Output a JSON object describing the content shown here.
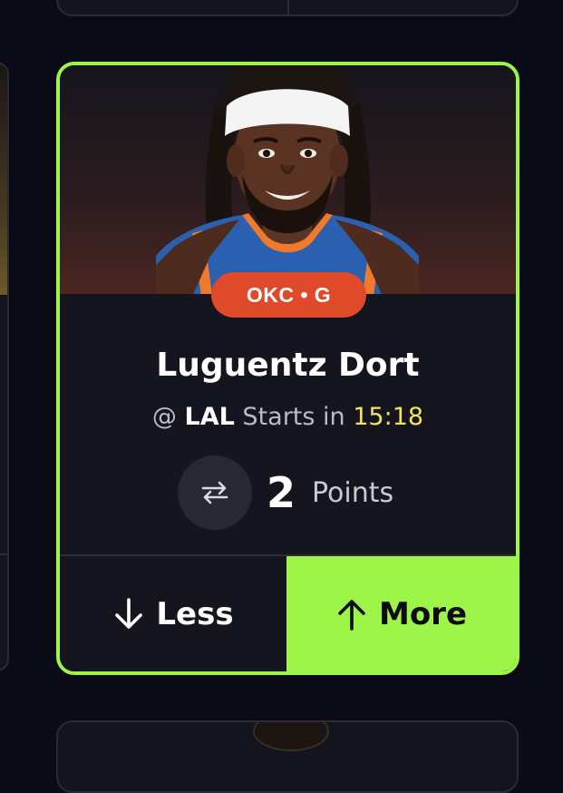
{
  "player": {
    "name": "Luguentz Dort",
    "team_badge": "OKC • G",
    "matchup_prefix": "@",
    "opponent": "LAL",
    "status_text": "Starts in",
    "countdown": "15:18"
  },
  "projection": {
    "value": "2",
    "stat": "Points",
    "swap_icon": "swap-arrows-icon"
  },
  "actions": {
    "less_label": "Less",
    "more_label": "More"
  },
  "colors": {
    "accent": "#9ef54a",
    "team_badge": "#de4a2a",
    "countdown": "#f2e457",
    "background": "#0b0b18",
    "card": "#15151f"
  }
}
